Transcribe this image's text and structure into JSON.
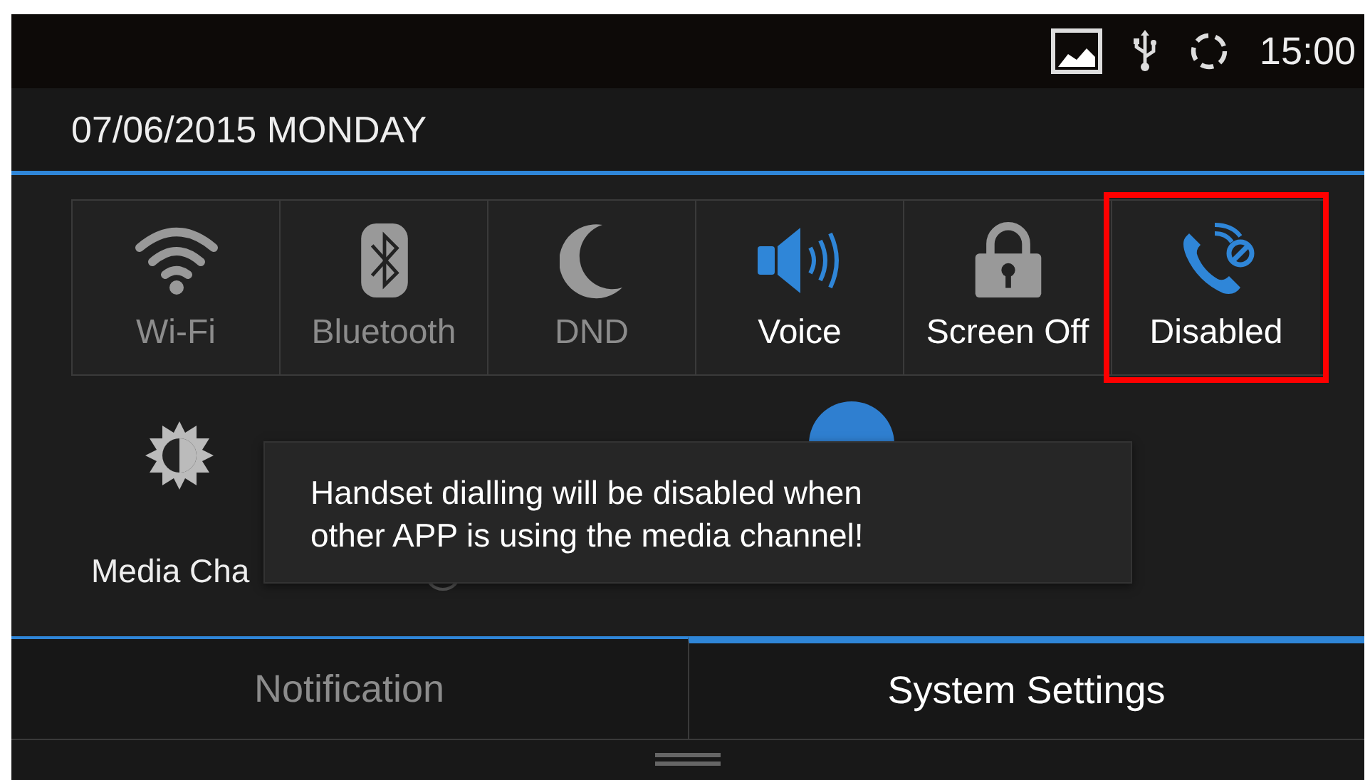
{
  "status_bar": {
    "time": "15:00"
  },
  "header": {
    "date": "07/06/2015 MONDAY"
  },
  "tiles": [
    {
      "kind": "wifi",
      "label": "Wi-Fi",
      "disabled": true,
      "on": false,
      "highlighted": false
    },
    {
      "kind": "bluetooth",
      "label": "Bluetooth",
      "disabled": true,
      "on": false,
      "highlighted": false
    },
    {
      "kind": "dnd",
      "label": "DND",
      "disabled": true,
      "on": false,
      "highlighted": false
    },
    {
      "kind": "voice",
      "label": "Voice",
      "disabled": false,
      "on": true,
      "highlighted": false
    },
    {
      "kind": "screen_off",
      "label": "Screen Off",
      "disabled": false,
      "on": false,
      "highlighted": false
    },
    {
      "kind": "handset",
      "label": "Disabled",
      "disabled": false,
      "on": true,
      "highlighted": true
    }
  ],
  "media_channel": {
    "label": "Media Cha",
    "selected": false
  },
  "toast": {
    "message": "Handset dialling will be disabled when other APP is using the media channel!"
  },
  "tabs": [
    {
      "label": "Notification",
      "selected": false
    },
    {
      "label": "System Settings",
      "selected": true
    }
  ]
}
